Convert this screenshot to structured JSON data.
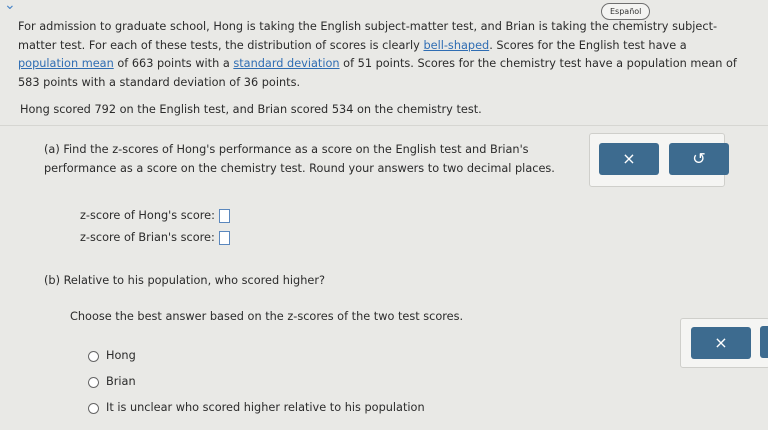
{
  "header": {
    "language_button": "Español"
  },
  "intro": {
    "p1": "For admission to graduate school, Hong is taking the English subject-matter test, and Brian is taking the chemistry subject-matter test. For each of these tests, the distribution of scores is clearly ",
    "link_bell": "bell-shaped",
    "p2": ". Scores for the English test have a ",
    "link_pop_mean": "population mean",
    "p3": " of 663 points with a ",
    "link_std_dev": "standard deviation",
    "p4": " of 51 points. Scores for the chemistry test have a population mean of 583 points with a standard deviation of 36 points."
  },
  "statement": "Hong scored 792 on the English test, and Brian scored 534 on the chemistry test.",
  "part_a": {
    "label": "(a)",
    "question": "Find the z-scores of Hong's performance as a score on the English test and Brian's performance as a score on the chemistry test. Round your answers to two decimal places.",
    "hong_label": "z-score of Hong's score:",
    "brian_label": "z-score of Brian's score:",
    "hong_value": "",
    "brian_value": ""
  },
  "tools_a": {
    "clear_icon": "×",
    "undo_icon": "↺"
  },
  "part_b": {
    "label": "(b)",
    "question": "Relative to his population, who scored higher?",
    "instruction": "Choose the best answer based on the z-scores of the two test scores.",
    "options": [
      "Hong",
      "Brian",
      "It is unclear who scored higher relative to his population"
    ]
  },
  "tools_b": {
    "clear_icon": "×"
  }
}
